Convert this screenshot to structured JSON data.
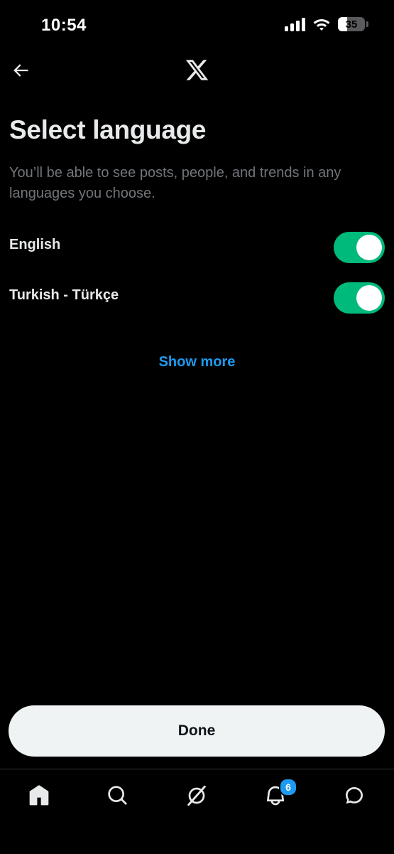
{
  "status_bar": {
    "time": "10:54",
    "battery_level": "35",
    "battery_fraction": 0.35
  },
  "header": {
    "back_icon": "arrow-left-icon",
    "logo_icon": "x-logo-icon"
  },
  "main": {
    "title": "Select language",
    "description": "You’ll be able to see posts, people, and trends in any languages you choose.",
    "languages": [
      {
        "label": "English",
        "enabled": true
      },
      {
        "label": "Turkish - Türkçe",
        "enabled": true
      }
    ],
    "show_more_label": "Show more"
  },
  "footer": {
    "done_label": "Done"
  },
  "bottom_nav": {
    "items": [
      {
        "icon": "home-icon"
      },
      {
        "icon": "search-icon"
      },
      {
        "icon": "grok-icon"
      },
      {
        "icon": "bell-icon",
        "badge": "6"
      },
      {
        "icon": "messages-icon"
      }
    ]
  },
  "colors": {
    "background": "#000000",
    "text_primary": "#e7e9ea",
    "text_secondary": "#71767b",
    "accent": "#1d9bf0",
    "toggle_on": "#00ba7c",
    "button_bg": "#eff3f4"
  }
}
